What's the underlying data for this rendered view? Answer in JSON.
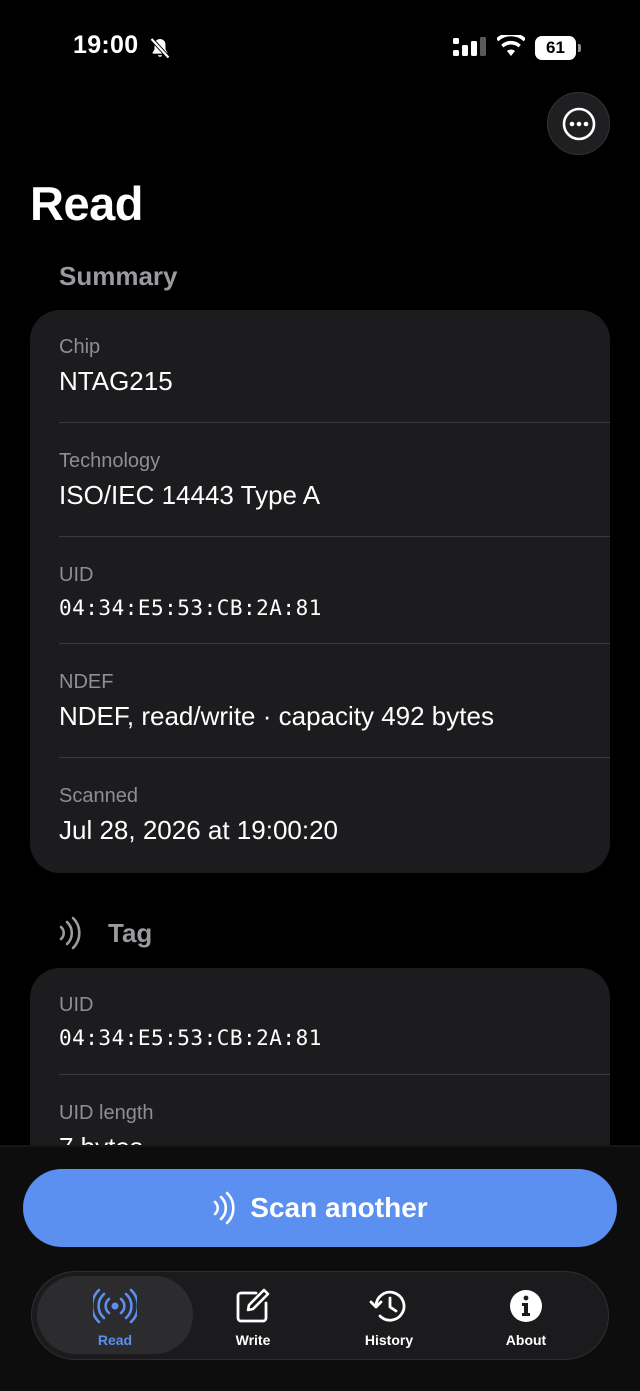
{
  "status_bar": {
    "time": "19:00",
    "battery": "61"
  },
  "header": {
    "title": "Read"
  },
  "summary": {
    "section_title": "Summary",
    "rows": [
      {
        "label": "Chip",
        "value": "NTAG215"
      },
      {
        "label": "Technology",
        "value": "ISO/IEC 14443 Type A"
      },
      {
        "label": "UID",
        "value": "04:34:E5:53:CB:2A:81"
      },
      {
        "label": "NDEF",
        "value": "NDEF, read/write · capacity 492 bytes"
      },
      {
        "label": "Scanned",
        "value": "Jul 28, 2026 at 19:00:20"
      }
    ]
  },
  "tag": {
    "section_title": "Tag",
    "rows": [
      {
        "label": "UID",
        "value": "04:34:E5:53:CB:2A:81"
      },
      {
        "label": "UID length",
        "value": "7 bytes"
      }
    ]
  },
  "scan_button": {
    "label": "Scan another"
  },
  "tabs": [
    {
      "label": "Read",
      "icon": "nfc-read-icon",
      "active": true
    },
    {
      "label": "Write",
      "icon": "square-pencil-icon"
    },
    {
      "label": "History",
      "icon": "clock-history-icon"
    },
    {
      "label": "About",
      "icon": "info-circle-icon"
    }
  ],
  "colors": {
    "accent": "#5b8ff0",
    "card": "#1c1c1e",
    "background": "#000000"
  }
}
